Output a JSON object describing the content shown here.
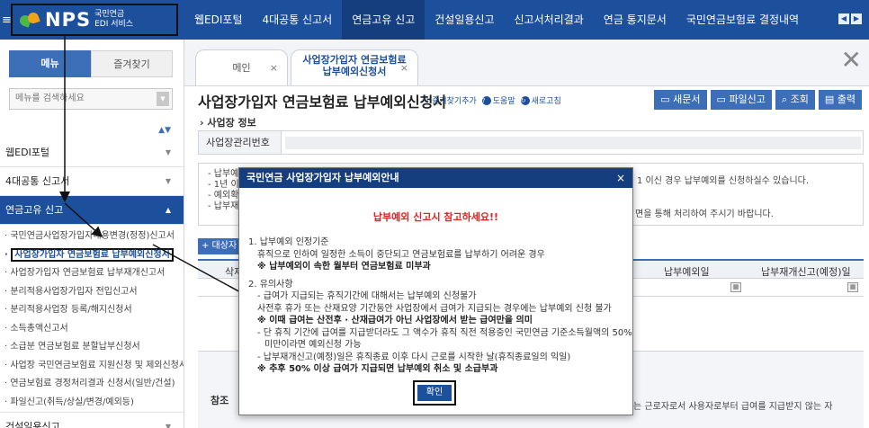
{
  "logo": {
    "brand": "NPS",
    "sub_line1": "국민연금",
    "sub_line2": "EDI 서비스"
  },
  "nav": {
    "items": [
      "웹EDI포털",
      "4대공통 신고서",
      "연금고유 신고",
      "건설일용신고",
      "신고서처리결과",
      "연금 통지문서",
      "국민연금보험료 결정내역"
    ],
    "active_index": 2
  },
  "sidebar": {
    "tab_menu": "메뉴",
    "tab_favorites": "즐겨찾기",
    "search_placeholder": "메뉴를 검색하세요",
    "groups": [
      "웹EDI포털",
      "4대공통 신고서",
      "연금고유 신고"
    ],
    "subitems": [
      "국민연금사업장가입자내용변경(정정)신고서",
      "사업장가입자 연금보험료 납부예외신청서",
      "사업장가입자 연금보험료 납부재개신고서",
      "분리적용사업장가입자 전입신고서",
      "분리적용사업장 등록/해지신청서",
      "소득총액신고서",
      "소급분 연금보험료 분할납부신청서",
      "사업장 국민연금보험료 지원신청 및 제외신청서",
      "연금보험료 경정처리결과 신청서(일반/건설)",
      "파일신고(취득/상실/변경/예외등)"
    ],
    "last_group": "건설일용신고"
  },
  "tabs": {
    "main": "메인",
    "current_line1": "사업장가입자 연금보험료",
    "current_line2": "납부예외신청서"
  },
  "page": {
    "title": "사업장가입자 연금보험료 납부예외신청서",
    "link_favorite": "즐겨찾기추가",
    "link_help": "도움말",
    "link_refresh": "새로고침",
    "btn_new": "새문서",
    "btn_file": "파일신고",
    "btn_search": "조회",
    "btn_print": "출력",
    "section_title": "› 사업장 정보",
    "label_business_no": "사업장관리번호",
    "notice_lines": [
      "- 납부예",
      "- 1년 이",
      "- 예외확",
      "- 납부재"
    ],
    "notice_right1": "1 이신 경우 납부예외를 신청하실수 있습니다.",
    "notice_right2": "면을 통해 처리하여 주시기 바랍니다.",
    "add_button": "+ 대상자",
    "col_seq": "삭제",
    "col_exception_date": "납부예외일",
    "col_resume_date": "납부재개신고(예정)일",
    "ref_label": "참조",
    "ref_text": "는 근로자로서 사용자로부터 급여를 지급받지 않는 자"
  },
  "modal": {
    "title": "국민연금 사업장가입자 납부예외안내",
    "warning": "납부예외 신고시 참고하세요!!",
    "lines": [
      "1. 납부예외 인정기준",
      "휴직으로 인하여 일정한 소득이 중단되고 연금보험료를 납부하기 어려운 경우",
      "※ 납부예외이 속한 월부터 연금보험료 미부과",
      "2. 유의사항",
      "- 급여가 지급되는 휴직기간에 대해서는 납부예외 신청불가",
      "사전후 휴가 또는 산재요양 기간동안 사업장에서 급여가 지급되는 경우에는 납부예외 신청 불가",
      "※ 이때 급여는 산전후 · 산재급여가 아닌 사업장에서 받는 급여만을 의미",
      "- 단 휴직 기간에 급여를 지급받더라도 그 액수가 휴직 직전 적용중인 국민연금 기준소득월액의 50%",
      "미만이라면 예외신청 가능",
      "- 납부재개신고(예정)일은 휴직종료 이후 다시 근로를 시작한 날(휴직종료일의 익일)",
      "※ 추후 50% 이상 급여가 지급되면 납부예외 취소 및 소급부과"
    ],
    "ok": "확인"
  },
  "colors": {
    "nav_bg": "#1c4f9c",
    "accent": "#3d6fb8",
    "warning": "#e02020"
  }
}
